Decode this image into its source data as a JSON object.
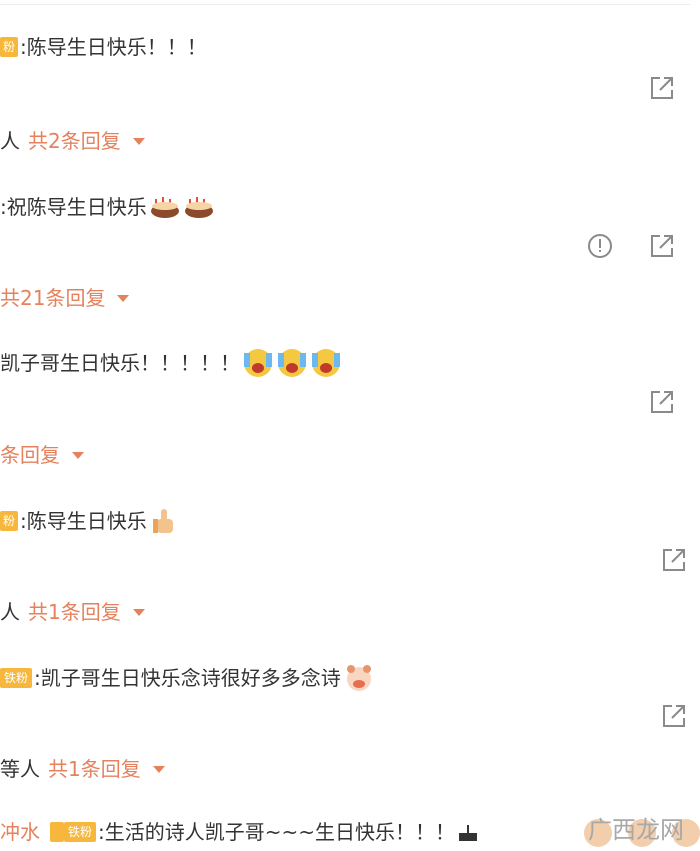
{
  "comments": [
    {
      "badge": "粉",
      "text": ":陈导生日快乐！！！"
    },
    {
      "text": ":祝陈导生日快乐"
    },
    {
      "text": "凯子哥生日快乐！！！！！"
    },
    {
      "badge": "粉",
      "text": ":陈导生日快乐"
    },
    {
      "badge": "铁粉",
      "text": ":凯子哥生日快乐念诗很好多多念诗"
    },
    {
      "name": "冲水",
      "badge": "铁粉",
      "text": ":生活的诗人凯子哥~~~生日快乐！！！"
    }
  ],
  "replies": [
    {
      "prefix": "人",
      "text": "共2条回复"
    },
    {
      "prefix": "",
      "text": "共21条回复"
    },
    {
      "prefix": "",
      "text": "条回复"
    },
    {
      "prefix": "人",
      "text": "共1条回复"
    },
    {
      "prefix": "等人",
      "text": "共1条回复"
    }
  ],
  "icons": {
    "share": "share-external-icon",
    "report": "report-exclamation-icon",
    "cake": "birthday-cake-emoji",
    "laugh": "laughing-tears-emoji",
    "thumbs": "thumbs-up-emoji",
    "pig": "cute-pig-emoji"
  },
  "watermark": {
    "text": "广西龙网"
  },
  "colors": {
    "reply": "#e5815d",
    "badge": "#f6b73c",
    "icon": "#8a8a8a"
  }
}
